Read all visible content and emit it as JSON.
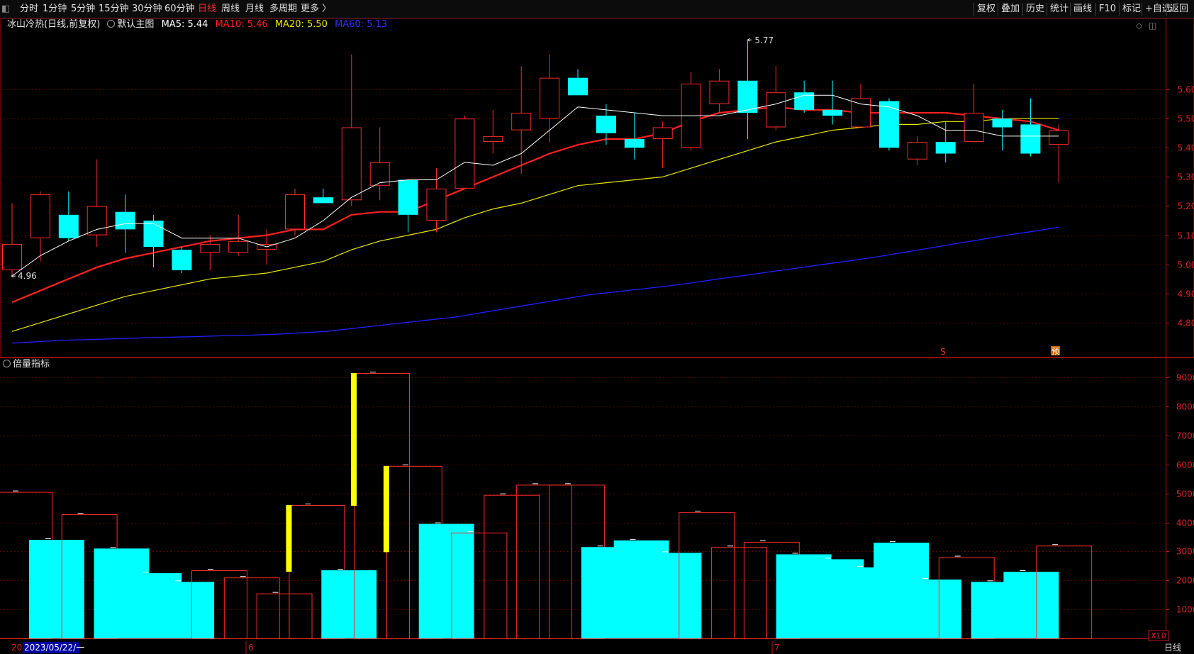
{
  "toolbar": {
    "left_items": [
      "分时",
      "1分钟",
      "5分钟",
      "15分钟",
      "30分钟",
      "60分钟",
      "日线",
      "周线",
      "月线",
      "多周期",
      "更多 〉"
    ],
    "active": "日线",
    "right_items": [
      "复权",
      "叠加",
      "历史",
      "统计",
      "画线",
      "F10",
      "标记",
      "+自选",
      "返回"
    ]
  },
  "legend": {
    "name": "冰山冷热(日线,前复权)",
    "main": "默认主图",
    "ma5": "MA5: 5.44",
    "ma10": "MA10: 5.46",
    "ma20": "MA20: 5.50",
    "ma60": "MA60: 5.13"
  },
  "volume_panel": {
    "title": "倍量指标",
    "unit": "X10"
  },
  "bottom": {
    "date_cursor": "2023/05/22/一",
    "year_fragment": "20",
    "month_labels": [
      "6",
      "7"
    ],
    "period": "日线"
  },
  "annotations": {
    "high_label": "5.77",
    "low_label": "4.96",
    "marker_s": "S",
    "marker_end": "预"
  },
  "colors": {
    "up": "#ff2b2b",
    "down": "#00ffff",
    "ma5": "#ffffff",
    "ma10": "#ff2020",
    "ma20": "#e6e600",
    "ma60": "#2020ff",
    "axis": "#c01818",
    "highlight": "#ffff00"
  },
  "chart_data": [
    {
      "type": "candlestick",
      "title": "冰山冷热(日线,前复权)",
      "y_ticks": [
        4.8,
        4.9,
        5.0,
        5.1,
        5.2,
        5.3,
        5.4,
        5.5,
        5.6
      ],
      "ylim": [
        4.7,
        5.79
      ],
      "candles": [
        {
          "o": 4.98,
          "h": 5.21,
          "l": 4.96,
          "c": 5.07
        },
        {
          "o": 5.09,
          "h": 5.25,
          "l": 5.01,
          "c": 5.24
        },
        {
          "o": 5.17,
          "h": 5.25,
          "l": 5.08,
          "c": 5.09
        },
        {
          "o": 5.1,
          "h": 5.36,
          "l": 5.06,
          "c": 5.2
        },
        {
          "o": 5.18,
          "h": 5.24,
          "l": 5.04,
          "c": 5.12
        },
        {
          "o": 5.15,
          "h": 5.17,
          "l": 4.99,
          "c": 5.06
        },
        {
          "o": 5.05,
          "h": 5.06,
          "l": 4.97,
          "c": 4.98
        },
        {
          "o": 5.04,
          "h": 5.1,
          "l": 4.98,
          "c": 5.07
        },
        {
          "o": 5.04,
          "h": 5.17,
          "l": 5.03,
          "c": 5.08
        },
        {
          "o": 5.05,
          "h": 5.12,
          "l": 5.0,
          "c": 5.07
        },
        {
          "o": 5.12,
          "h": 5.26,
          "l": 5.1,
          "c": 5.24
        },
        {
          "o": 5.23,
          "h": 5.26,
          "l": 5.21,
          "c": 5.21
        },
        {
          "o": 5.22,
          "h": 5.72,
          "l": 5.2,
          "c": 5.47
        },
        {
          "o": 5.27,
          "h": 5.47,
          "l": 5.22,
          "c": 5.35
        },
        {
          "o": 5.29,
          "h": 5.29,
          "l": 5.11,
          "c": 5.17
        },
        {
          "o": 5.15,
          "h": 5.33,
          "l": 5.11,
          "c": 5.26
        },
        {
          "o": 5.26,
          "h": 5.51,
          "l": 5.26,
          "c": 5.5
        },
        {
          "o": 5.42,
          "h": 5.53,
          "l": 5.38,
          "c": 5.44
        },
        {
          "o": 5.46,
          "h": 5.68,
          "l": 5.31,
          "c": 5.52
        },
        {
          "o": 5.5,
          "h": 5.72,
          "l": 5.42,
          "c": 5.64
        },
        {
          "o": 5.64,
          "h": 5.67,
          "l": 5.58,
          "c": 5.58
        },
        {
          "o": 5.51,
          "h": 5.55,
          "l": 5.41,
          "c": 5.45
        },
        {
          "o": 5.43,
          "h": 5.52,
          "l": 5.36,
          "c": 5.4
        },
        {
          "o": 5.43,
          "h": 5.49,
          "l": 5.33,
          "c": 5.47
        },
        {
          "o": 5.4,
          "h": 5.66,
          "l": 5.39,
          "c": 5.62
        },
        {
          "o": 5.55,
          "h": 5.67,
          "l": 5.52,
          "c": 5.63
        },
        {
          "o": 5.63,
          "h": 5.77,
          "l": 5.43,
          "c": 5.52
        },
        {
          "o": 5.47,
          "h": 5.68,
          "l": 5.46,
          "c": 5.59
        },
        {
          "o": 5.59,
          "h": 5.63,
          "l": 5.52,
          "c": 5.53
        },
        {
          "o": 5.53,
          "h": 5.63,
          "l": 5.48,
          "c": 5.51
        },
        {
          "o": 5.47,
          "h": 5.62,
          "l": 5.47,
          "c": 5.57
        },
        {
          "o": 5.56,
          "h": 5.57,
          "l": 5.39,
          "c": 5.4
        },
        {
          "o": 5.36,
          "h": 5.44,
          "l": 5.34,
          "c": 5.42
        },
        {
          "o": 5.42,
          "h": 5.49,
          "l": 5.35,
          "c": 5.38
        },
        {
          "o": 5.42,
          "h": 5.62,
          "l": 5.42,
          "c": 5.52
        },
        {
          "o": 5.5,
          "h": 5.53,
          "l": 5.39,
          "c": 5.47
        },
        {
          "o": 5.48,
          "h": 5.57,
          "l": 5.37,
          "c": 5.38
        },
        {
          "o": 5.41,
          "h": 5.48,
          "l": 5.28,
          "c": 5.46
        }
      ],
      "ma5": [
        4.96,
        5.03,
        5.08,
        5.12,
        5.14,
        5.14,
        5.09,
        5.09,
        5.09,
        5.06,
        5.09,
        5.15,
        5.23,
        5.28,
        5.29,
        5.29,
        5.35,
        5.34,
        5.38,
        5.46,
        5.54,
        5.53,
        5.52,
        5.51,
        5.51,
        5.51,
        5.53,
        5.55,
        5.58,
        5.58,
        5.55,
        5.54,
        5.51,
        5.46,
        5.46,
        5.44,
        5.44,
        5.44
      ],
      "ma10": [
        4.87,
        4.91,
        4.95,
        4.99,
        5.02,
        5.04,
        5.06,
        5.08,
        5.09,
        5.1,
        5.12,
        5.12,
        5.17,
        5.18,
        5.18,
        5.22,
        5.26,
        5.3,
        5.34,
        5.38,
        5.41,
        5.43,
        5.43,
        5.45,
        5.49,
        5.52,
        5.53,
        5.54,
        5.53,
        5.53,
        5.52,
        5.52,
        5.52,
        5.52,
        5.51,
        5.5,
        5.49,
        5.46
      ],
      "ma20": [
        4.77,
        4.8,
        4.83,
        4.86,
        4.89,
        4.91,
        4.93,
        4.95,
        4.96,
        4.97,
        4.99,
        5.01,
        5.05,
        5.08,
        5.1,
        5.12,
        5.16,
        5.19,
        5.21,
        5.24,
        5.27,
        5.28,
        5.29,
        5.3,
        5.33,
        5.36,
        5.39,
        5.42,
        5.44,
        5.46,
        5.47,
        5.48,
        5.48,
        5.49,
        5.49,
        5.5,
        5.5,
        5.5
      ],
      "ma60": [
        4.73,
        4.735,
        4.74,
        4.742,
        4.745,
        4.748,
        4.75,
        4.752,
        4.755,
        4.757,
        4.76,
        4.765,
        4.77,
        4.78,
        4.79,
        4.8,
        4.81,
        4.82,
        4.835,
        4.85,
        4.865,
        4.88,
        4.895,
        4.905,
        4.915,
        4.925,
        4.937,
        4.95,
        4.962,
        4.975,
        4.987,
        5.0,
        5.012,
        5.025,
        5.04,
        5.055,
        5.07,
        5.085,
        5.1,
        5.113,
        5.128
      ],
      "ma60_start_index": 0
    },
    {
      "type": "bar",
      "title": "倍量指标",
      "y_ticks": [
        10000,
        20000,
        30000,
        40000,
        50000,
        60000,
        70000,
        80000,
        90000
      ],
      "ylim": [
        0,
        92000
      ],
      "volumes": [
        50500,
        34000,
        42800,
        31000,
        22500,
        19500,
        23500,
        21000,
        15500,
        46000,
        23500,
        91500,
        59500,
        39500,
        36500,
        49500,
        53000,
        53000,
        31500,
        33800,
        29500,
        43500,
        31500,
        33300,
        29000,
        27300,
        24500,
        33000,
        20300,
        28000,
        19500,
        23000,
        32000
      ],
      "up": [
        true,
        false,
        true,
        false,
        false,
        false,
        true,
        true,
        true,
        true,
        false,
        true,
        true,
        false,
        true,
        true,
        true,
        true,
        false,
        false,
        false,
        true,
        true,
        true,
        false,
        false,
        false,
        false,
        false,
        true,
        false,
        false,
        true
      ],
      "double_volume": [
        false,
        false,
        false,
        false,
        false,
        false,
        false,
        false,
        false,
        true,
        false,
        true,
        true,
        false,
        false,
        false,
        false,
        false,
        false,
        false,
        false,
        false,
        false,
        false,
        false,
        false,
        false,
        false,
        false,
        false,
        false,
        false,
        false
      ]
    }
  ]
}
